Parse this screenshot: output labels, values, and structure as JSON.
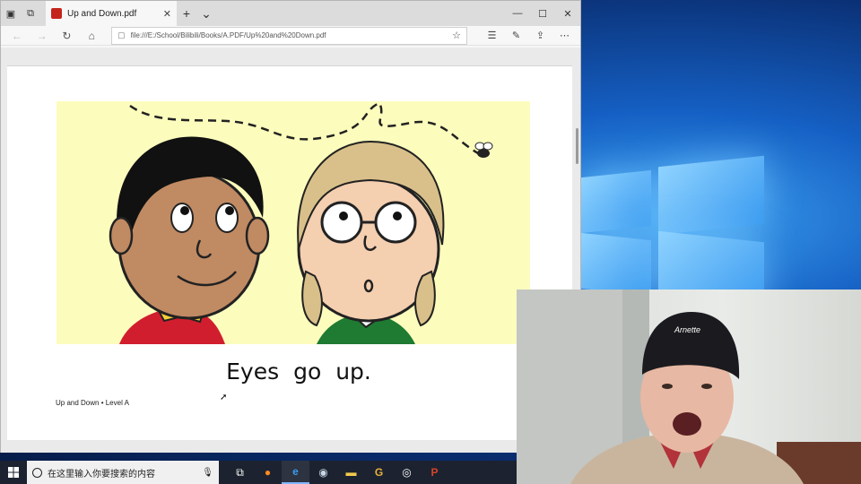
{
  "browser": {
    "tab_title": "Up and Down.pdf",
    "address_url": "file:///E:/School/Bilibili/Books/A.PDF/Up%20and%20Down.pdf"
  },
  "pdf": {
    "caption": "Eyes go up.",
    "footer": "Up and Down • Level A"
  },
  "taskbar": {
    "search_placeholder": "在这里输入你要搜索的内容"
  },
  "webcam": {
    "hat_text": "Arnette"
  },
  "colors": {
    "illustration_bg": "#fcfcbd",
    "taskbar_bg": "#1c2230",
    "pdf_red": "#c4241c"
  }
}
